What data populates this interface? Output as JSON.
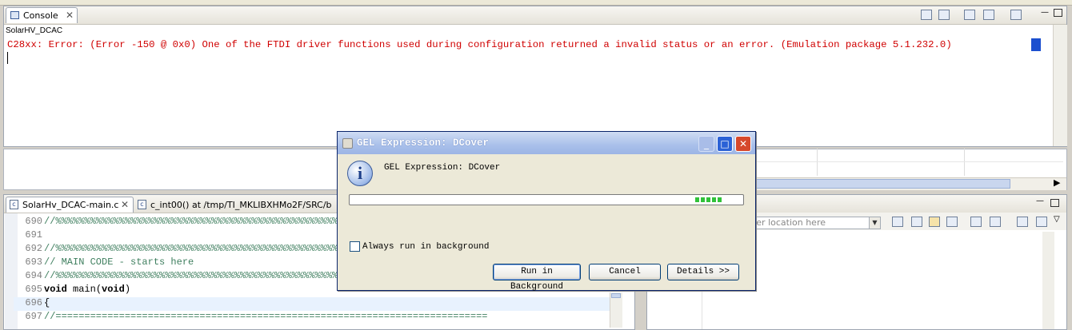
{
  "console": {
    "tab_label": "Console",
    "close_glyph": "✕",
    "session_name": "SolarHV_DCAC",
    "error_text": "C28xx: Error: (Error -150 @ 0x0) One of the FTDI driver functions used during configuration returned a invalid status or an error. (Emulation package 5.1.232.0)"
  },
  "editor": {
    "tabs": [
      {
        "label": "SolarHv_DCAC-main.c",
        "close_glyph": "✕"
      },
      {
        "label": "c_int00() at /tmp/TI_MKLIBXHMo2F/SRC/b"
      }
    ],
    "lines": [
      {
        "num": "690",
        "text": "//%%%%%%%%%%%%%%%%%%%%%%%%%%%%%%%%%%%%%%%%%%%%%%%%%%%%%%%%"
      },
      {
        "num": "691",
        "text": ""
      },
      {
        "num": "692",
        "text": "//%%%%%%%%%%%%%%%%%%%%%%%%%%%%%%%%%%%%%%%%%%%%%%%%%%%%%%%%"
      },
      {
        "num": "693",
        "text": "// MAIN CODE - starts here"
      },
      {
        "num": "694",
        "text": "//%%%%%%%%%%%%%%%%%%%%%%%%%%%%%%%%%%%%%%%%%%%%%%%%%%%%%%%%"
      },
      {
        "num": "695",
        "kw1": "void",
        "mid": " main(",
        "kw2": "void",
        "tail": ")"
      },
      {
        "num": "696",
        "text": "{"
      },
      {
        "num": "697",
        "text": "//==========================================================================="
      }
    ]
  },
  "right_panel": {
    "location_placeholder": "nter location here"
  },
  "dialog": {
    "title": "GEL Expression: DCover",
    "message": "GEL Expression: DCover",
    "progress_fraction": 0.96,
    "checkbox_label": "Always run in background",
    "checkbox_checked": false,
    "buttons": {
      "run_in_background": "Run in Background",
      "cancel": "Cancel",
      "details": "Details >>"
    },
    "title_buttons": {
      "minimize": "_",
      "maximize": "□",
      "close": "✕"
    }
  },
  "icons": {
    "console": "console-icon",
    "info": "info-icon",
    "c_file": "c-file-icon"
  },
  "colors": {
    "error_text": "#d00000",
    "comment": "#3f7f5f",
    "selection": "#1b4fcf",
    "titlebar": "#9cb5e5",
    "progress": "#31c23a"
  }
}
